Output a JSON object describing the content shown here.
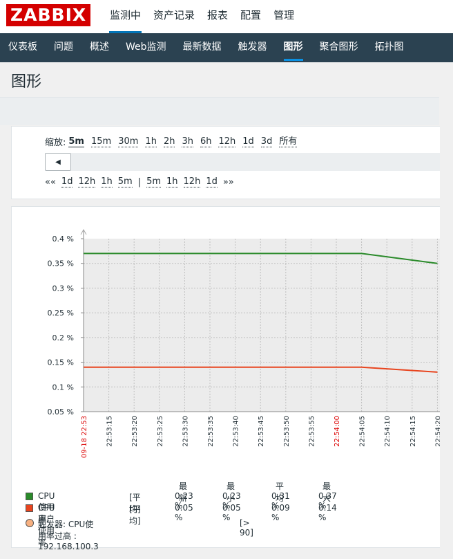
{
  "header": {
    "logo": "ZABBIX",
    "nav": [
      "监测中",
      "资产记录",
      "报表",
      "配置",
      "管理"
    ],
    "active_nav": 0
  },
  "subnav": {
    "items": [
      "仪表板",
      "问题",
      "概述",
      "Web监测",
      "最新数据",
      "触发器",
      "图形",
      "聚合图形",
      "拓扑图"
    ],
    "active": 6
  },
  "page": {
    "title": "图形"
  },
  "timecontrol": {
    "zoom_label": "缩放:",
    "zoom_options": [
      "5m",
      "15m",
      "30m",
      "1h",
      "2h",
      "3h",
      "6h",
      "12h",
      "1d",
      "3d",
      "所有"
    ],
    "zoom_selected": 0,
    "back_prev": "««",
    "back_links": [
      "1d",
      "12h",
      "1h",
      "5m"
    ],
    "separator": "|",
    "fwd_links": [
      "5m",
      "1h",
      "12h",
      "1d"
    ],
    "fwd_next": "»»"
  },
  "chart_data": {
    "type": "line",
    "y_ticks": [
      "0.4 %",
      "0.35 %",
      "0.3 %",
      "0.25 %",
      "0.2 %",
      "0.15 %",
      "0.1 %",
      "0.05 %"
    ],
    "ylim": [
      0.05,
      0.4
    ],
    "x_ticks": [
      "09-18 22:53",
      "22:53:15",
      "22:53:20",
      "22:53:25",
      "22:53:30",
      "22:53:35",
      "22:53:40",
      "22:53:45",
      "22:53:50",
      "22:53:55",
      "22:54:00",
      "22:54:05",
      "22:54:10",
      "22:54:15",
      "22:54:20"
    ],
    "red_ticks": [
      "09-18 22:53",
      "22:54:00"
    ],
    "grid": true,
    "series": [
      {
        "name": "CPU 使用率",
        "color": "#2a8a2a",
        "x": [
          "09-18 22:53",
          "22:54:05",
          "22:54:20"
        ],
        "values": [
          0.37,
          0.37,
          0.35
        ]
      },
      {
        "name": "CPU 用户使用率",
        "color": "#e8441e",
        "x": [
          "09-18 22:53",
          "22:54:05",
          "22:54:20"
        ],
        "values": [
          0.14,
          0.14,
          0.13
        ]
      }
    ]
  },
  "legend": {
    "headers": [
      "最新",
      "最小",
      "平均",
      "最大"
    ],
    "rows": [
      {
        "name": "CPU 使用率",
        "func": "[平均]",
        "last": "0.23 %",
        "min": "0.23 %",
        "avg": "0.31 %",
        "max": "0.37 %",
        "color": "#2a8a2a"
      },
      {
        "name": "CPU 用户使用率",
        "func": "[平均]",
        "last": "0.05 %",
        "min": "0.05 %",
        "avg": "0.09 %",
        "max": "0.14 %",
        "color": "#e8441e"
      }
    ],
    "trigger": {
      "text": "触发器: CPU使用率过高 : 192.168.100.3",
      "threshold": "[> 90]",
      "color": "#f7b080"
    }
  }
}
